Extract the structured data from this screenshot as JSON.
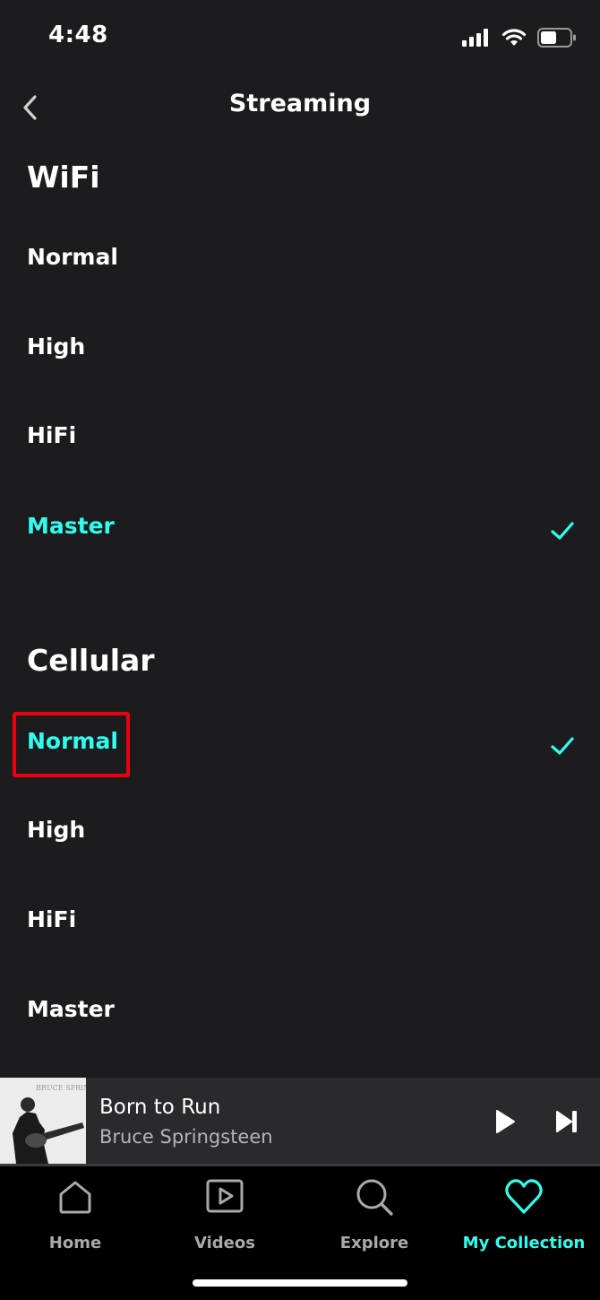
{
  "status_bar": {
    "time": "4:48",
    "icons": [
      "signal-icon",
      "wifi-icon",
      "battery-icon"
    ]
  },
  "header": {
    "title": "Streaming",
    "back_icon": "chevron-left-icon"
  },
  "wifi": {
    "title": "WiFi",
    "options": [
      {
        "label": "Normal",
        "selected": false
      },
      {
        "label": "High",
        "selected": false
      },
      {
        "label": "HiFi",
        "selected": false
      },
      {
        "label": "Master",
        "selected": true
      }
    ]
  },
  "cellular": {
    "title": "Cellular",
    "options": [
      {
        "label": "Normal",
        "selected": true
      },
      {
        "label": "High",
        "selected": false
      },
      {
        "label": "HiFi",
        "selected": false
      },
      {
        "label": "Master",
        "selected": false
      }
    ]
  },
  "player": {
    "track_title": "Born to Run",
    "artist": "Bruce Springsteen",
    "album_art_text": "BRUCE SPRINGSTEEN",
    "play_icon": "play-icon",
    "next_icon": "skip-next-icon"
  },
  "tabs": [
    {
      "label": "Home",
      "icon": "home-icon",
      "active": false
    },
    {
      "label": "Videos",
      "icon": "video-icon",
      "active": false
    },
    {
      "label": "Explore",
      "icon": "search-icon",
      "active": false
    },
    {
      "label": "My Collection",
      "icon": "heart-icon",
      "active": true
    }
  ],
  "colors": {
    "accent": "#33ffee",
    "background": "#1c1c1e",
    "highlight_box": "#e8000b"
  }
}
